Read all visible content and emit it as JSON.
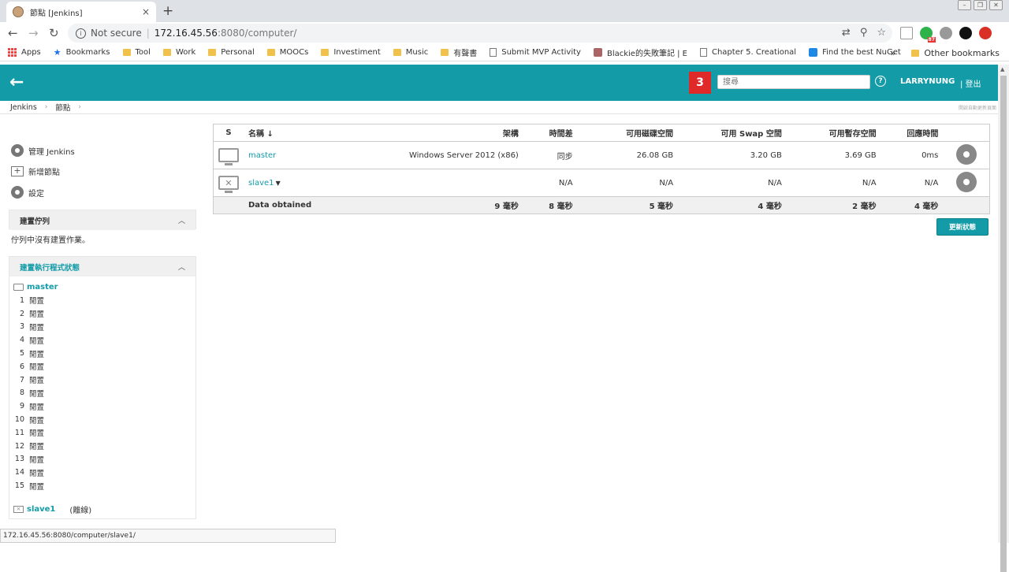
{
  "browser": {
    "tab_title": "節點 [Jenkins]",
    "tab_close": "×",
    "new_tab": "+",
    "not_secure": "Not secure",
    "url_host": "172.16.45.56",
    "url_path": ":8080/computer/",
    "extension_badge": "87",
    "bookmarks": [
      {
        "label": "Apps",
        "icon": "apps-grid-icon"
      },
      {
        "label": "Bookmarks",
        "icon": "star-icon"
      },
      {
        "label": "Tool",
        "icon": "folder-icon"
      },
      {
        "label": "Work",
        "icon": "folder-icon"
      },
      {
        "label": "Personal",
        "icon": "folder-icon"
      },
      {
        "label": "MOOCs",
        "icon": "folder-icon"
      },
      {
        "label": "Investiment",
        "icon": "folder-icon"
      },
      {
        "label": "Music",
        "icon": "folder-icon"
      },
      {
        "label": "有聲書",
        "icon": "folder-icon"
      },
      {
        "label": "Submit MVP Activity",
        "icon": "page-icon"
      },
      {
        "label": "Blackie的失敗筆記 | E",
        "icon": "avatar-icon"
      },
      {
        "label": "Chapter 5. Creational",
        "icon": "page-icon"
      },
      {
        "label": "Find the best NuGet",
        "icon": "nuget-icon"
      }
    ],
    "bookmarks_overflow": "»",
    "other_bookmarks": "Other bookmarks",
    "status_url": "172.16.45.56:8080/computer/slave1/"
  },
  "header": {
    "notification_count": "3",
    "search_placeholder": "搜尋",
    "user": "LARRYNUNG",
    "logout": "| 登出"
  },
  "breadcrumb": {
    "items": [
      "Jenkins",
      "節點"
    ],
    "auto_refresh": "開啟自動更新頁面"
  },
  "sidebar": {
    "tasks": [
      {
        "label": "管理 Jenkins",
        "icon": "gear-icon"
      },
      {
        "label": "新增節點",
        "icon": "add-node-icon"
      },
      {
        "label": "設定",
        "icon": "gear-icon"
      }
    ],
    "queue": {
      "title": "建置佇列",
      "empty_text": "佇列中沒有建置作業。"
    },
    "executors": {
      "title": "建置執行程式狀態",
      "master_label": "master",
      "master_executors": [
        {
          "num": "1",
          "status": "閒置"
        },
        {
          "num": "2",
          "status": "閒置"
        },
        {
          "num": "3",
          "status": "閒置"
        },
        {
          "num": "4",
          "status": "閒置"
        },
        {
          "num": "5",
          "status": "閒置"
        },
        {
          "num": "6",
          "status": "閒置"
        },
        {
          "num": "7",
          "status": "閒置"
        },
        {
          "num": "8",
          "status": "閒置"
        },
        {
          "num": "9",
          "status": "閒置"
        },
        {
          "num": "10",
          "status": "閒置"
        },
        {
          "num": "11",
          "status": "閒置"
        },
        {
          "num": "12",
          "status": "閒置"
        },
        {
          "num": "13",
          "status": "閒置"
        },
        {
          "num": "14",
          "status": "閒置"
        },
        {
          "num": "15",
          "status": "閒置"
        }
      ],
      "slave_label": "slave1",
      "slave_state": "(離線)"
    }
  },
  "table": {
    "columns": [
      "S",
      "名稱 ↓",
      "架構",
      "時間差",
      "可用磁碟空間",
      "可用 Swap 空間",
      "可用暫存空間",
      "回應時間"
    ],
    "rows": [
      {
        "name": "master",
        "arch": "Windows Server 2012 (x86)",
        "clock": "同步",
        "disk": "26.08 GB",
        "swap": "3.20 GB",
        "temp": "3.69 GB",
        "response": "0ms",
        "online": true
      },
      {
        "name": "slave1",
        "arch": "",
        "clock": "N/A",
        "disk": "N/A",
        "swap": "N/A",
        "temp": "N/A",
        "response": "N/A",
        "online": false
      }
    ],
    "footer": {
      "label": "Data obtained",
      "arch": "9 毫秒",
      "clock": "8 毫秒",
      "disk": "5 毫秒",
      "swap": "4 毫秒",
      "temp": "2 毫秒",
      "response": "4 毫秒"
    }
  },
  "refresh_button": "更新狀態"
}
